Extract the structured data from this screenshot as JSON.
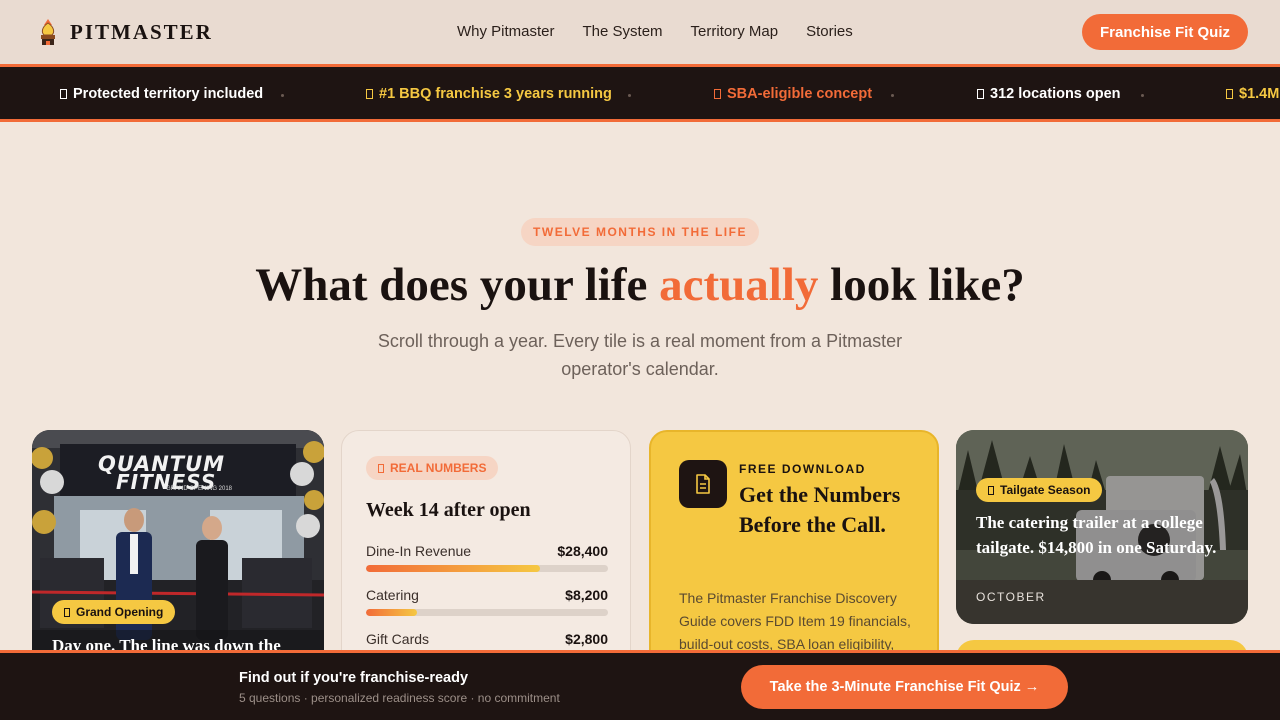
{
  "brand": {
    "name": "PITMASTER",
    "accent": "#f26b38",
    "gold": "#f5c842",
    "dark": "#1e1412"
  },
  "nav": {
    "items": [
      "Why Pitmaster",
      "The System",
      "Territory Map",
      "Stories"
    ]
  },
  "header_cta": "Franchise Fit Quiz",
  "ticker": {
    "items": [
      {
        "label": "Protected territory included",
        "color": "#ffffff"
      },
      {
        "label": "#1 BBQ franchise 3 years running",
        "color": "#f5c842"
      },
      {
        "label": "SBA-eligible concept",
        "color": "#f26b38"
      },
      {
        "label": "312 locations open",
        "color": "#ffffff"
      },
      {
        "label": "$1.4M",
        "color": "#f5c842"
      }
    ]
  },
  "hero": {
    "eyebrow": "TWELVE MONTHS IN THE LIFE",
    "headline_before": "What does your life ",
    "headline_accent": "actually",
    "headline_after": " look like?",
    "subhead": "Scroll through a year. Every tile is a real moment from a Pitmaster operator's calendar."
  },
  "cards": {
    "opening": {
      "tag": "Grand Opening",
      "caption": "Day one. The line was down the",
      "sign_line1": "QUANTUM",
      "sign_line2": "FITNESS",
      "sign_line3": "GRAND OPENING 2018"
    },
    "numbers": {
      "tag": "REAL NUMBERS",
      "title": "Week 14 after open",
      "rows": [
        {
          "label": "Dine-In Revenue",
          "value": "$28,400",
          "progress": 0.72
        },
        {
          "label": "Catering",
          "value": "$8,200",
          "progress": 0.21
        },
        {
          "label": "Gift Cards",
          "value": "$2,800",
          "progress": 0.08
        }
      ]
    },
    "download": {
      "eyebrow": "FREE DOWNLOAD",
      "title": "Get the Numbers Before the Call.",
      "body": "The Pitmaster Franchise Discovery Guide covers FDD Item 19 financials, build-out costs, SBA loan eligibility,"
    },
    "tailgate": {
      "tag": "Tailgate Season",
      "caption": "The catering trailer at a college tailgate. $14,800 in one Saturday.",
      "month": "OCTOBER"
    }
  },
  "bottom_bar": {
    "title": "Find out if you're franchise-ready",
    "subtitle": "5 questions · personalized readiness score · no commitment",
    "cta": "Take the 3-Minute Franchise Fit Quiz →"
  }
}
